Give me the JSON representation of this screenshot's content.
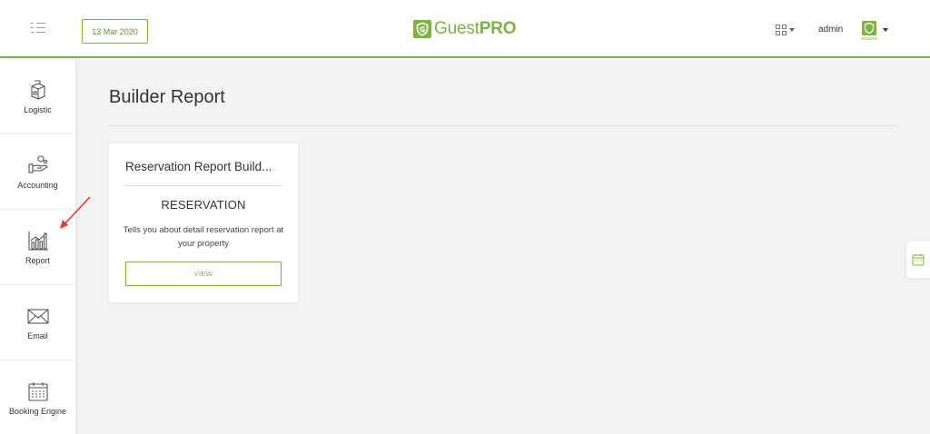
{
  "header": {
    "date": "13 Mar 2020",
    "brand": {
      "name_light": "Guest",
      "name_bold": "PRO"
    },
    "user": "admin",
    "brand_color": "#7cb342"
  },
  "sidebar": {
    "items": [
      {
        "label": "Logistic",
        "icon": "box-icon"
      },
      {
        "label": "Accounting",
        "icon": "accounting-icon"
      },
      {
        "label": "Report",
        "icon": "chart-icon"
      },
      {
        "label": "Email",
        "icon": "envelope-icon"
      },
      {
        "label": "Booking Engine",
        "icon": "calendar-icon"
      }
    ]
  },
  "main": {
    "title": "Builder Report",
    "cards": [
      {
        "title": "Reservation Report Build...",
        "category": "RESERVATION",
        "description": "Tells you about detail reservation report at your property",
        "button_label": "VIEW"
      }
    ]
  }
}
